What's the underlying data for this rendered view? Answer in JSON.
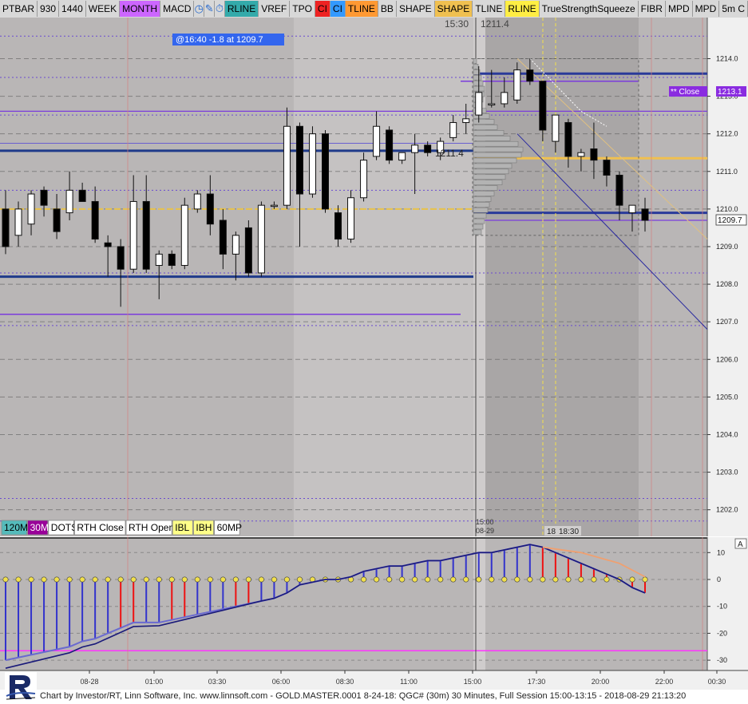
{
  "toolbar": [
    {
      "label": "PTBAR",
      "bg": "#d8d8d8"
    },
    {
      "label": "930",
      "bg": "#d8d8d8"
    },
    {
      "label": "1440",
      "bg": "#d8d8d8"
    },
    {
      "label": "WEEK",
      "bg": "#d8d8d8"
    },
    {
      "label": "MONTH",
      "bg": "#cc66ff"
    },
    {
      "label": "MACD",
      "bg": "#d8d8d8"
    },
    {
      "icon": "clock-icon",
      "bg": "#d8d8d8"
    },
    {
      "icon": "pencil-icon",
      "bg": "#d8d8d8"
    },
    {
      "icon": "stopwatch-icon",
      "bg": "#d8d8d8"
    },
    {
      "label": "RLINE",
      "bg": "#33aaaa"
    },
    {
      "label": "VREF",
      "bg": "#d8d8d8"
    },
    {
      "label": "TPO",
      "bg": "#d8d8d8"
    },
    {
      "label": "CI",
      "bg": "#ee2222"
    },
    {
      "label": "CI",
      "bg": "#3399ff"
    },
    {
      "label": "TLINE",
      "bg": "#ff9933"
    },
    {
      "label": "BB",
      "bg": "#d8d8d8"
    },
    {
      "label": "SHAPE",
      "bg": "#d8d8d8"
    },
    {
      "label": "SHAPE",
      "bg": "#f0c050"
    },
    {
      "label": "TLINE",
      "bg": "#d8d8d8"
    },
    {
      "label": "RLINE",
      "bg": "#ffee44"
    },
    {
      "label": "TrueStrengthSqueeze",
      "bg": "#d8d8d8"
    },
    {
      "label": "FIBR",
      "bg": "#d8d8d8"
    },
    {
      "label": "MPD",
      "bg": "#d8d8d8"
    },
    {
      "label": "MPD",
      "bg": "#d8d8d8"
    },
    {
      "label": "5m C",
      "bg": "#d8d8d8"
    }
  ],
  "bottom_buttons": [
    {
      "label": "120M",
      "bg": "#55bbbb"
    },
    {
      "label": "30M",
      "bg": "#990099",
      "color": "#ffffff"
    },
    {
      "label": "DOTS",
      "bg": "#ffffff"
    },
    {
      "label": "RTH Close",
      "bg": "#ffffff"
    },
    {
      "label": "RTH Open",
      "bg": "#ffffff"
    },
    {
      "label": "IBL",
      "bg": "#ffff88"
    },
    {
      "label": "IBH",
      "bg": "#ffff88"
    },
    {
      "label": "60MP",
      "bg": "#ffffff"
    }
  ],
  "cursor_info": "@16:40  -1.8 at 1209.7",
  "session_label_time": "15:30",
  "session_label_price": "1211.4",
  "mid_label": "1211.4",
  "close_tag": "** Close",
  "close_value": "1213.1",
  "last_price": "1209.7",
  "vline_label_time": "15:00",
  "vline_label_date": "08-29",
  "ib_label_1": "18",
  "ib_label_2": "18:30",
  "osc_pane_label": "A",
  "footer": "Chart by Investor/RT, Linn Software, Inc. www.linnsoft.com - GOLD.MASTER.0001  8-24-18: QGC# (30m) 30 Minutes, Full Session 15:00-13:15 - 2018-08-29 21:13:20",
  "chart_data": {
    "type": "candlestick",
    "price_ticks": [
      1214.0,
      1213.0,
      1212.0,
      1211.0,
      1210.0,
      1209.0,
      1208.0,
      1207.0,
      1206.0,
      1205.0,
      1204.0,
      1203.0,
      1202.0
    ],
    "price_range": [
      1201.55,
      1214.8
    ],
    "time_ticks": [
      "08-28",
      "01:00",
      "03:30",
      "06:00",
      "08:30",
      "11:00",
      "15:00",
      "17:30",
      "20:00",
      "22:00",
      "00:30"
    ],
    "candles": [
      {
        "o": 1210.0,
        "h": 1210.5,
        "l": 1208.8,
        "c": 1209.0
      },
      {
        "o": 1209.3,
        "h": 1210.2,
        "l": 1209.0,
        "c": 1210.0
      },
      {
        "o": 1209.6,
        "h": 1210.5,
        "l": 1209.3,
        "c": 1210.4
      },
      {
        "o": 1210.5,
        "h": 1210.6,
        "l": 1209.8,
        "c": 1210.1
      },
      {
        "o": 1210.0,
        "h": 1210.4,
        "l": 1209.2,
        "c": 1209.4
      },
      {
        "o": 1209.9,
        "h": 1211.0,
        "l": 1209.7,
        "c": 1210.5
      },
      {
        "o": 1210.5,
        "h": 1210.7,
        "l": 1210.2,
        "c": 1210.2
      },
      {
        "o": 1210.2,
        "h": 1210.6,
        "l": 1209.1,
        "c": 1209.2
      },
      {
        "o": 1209.1,
        "h": 1209.3,
        "l": 1208.2,
        "c": 1209.0
      },
      {
        "o": 1209.0,
        "h": 1209.2,
        "l": 1207.4,
        "c": 1208.4
      },
      {
        "o": 1208.4,
        "h": 1210.9,
        "l": 1208.3,
        "c": 1210.2
      },
      {
        "o": 1210.2,
        "h": 1210.9,
        "l": 1208.3,
        "c": 1208.4
      },
      {
        "o": 1208.5,
        "h": 1208.9,
        "l": 1207.6,
        "c": 1208.8
      },
      {
        "o": 1208.8,
        "h": 1208.9,
        "l": 1208.4,
        "c": 1208.5
      },
      {
        "o": 1208.5,
        "h": 1210.3,
        "l": 1208.4,
        "c": 1210.1
      },
      {
        "o": 1210.0,
        "h": 1210.5,
        "l": 1209.9,
        "c": 1210.4
      },
      {
        "o": 1210.4,
        "h": 1210.9,
        "l": 1209.3,
        "c": 1209.6
      },
      {
        "o": 1209.7,
        "h": 1210.0,
        "l": 1208.4,
        "c": 1208.8
      },
      {
        "o": 1208.8,
        "h": 1209.4,
        "l": 1208.1,
        "c": 1209.3
      },
      {
        "o": 1209.5,
        "h": 1209.7,
        "l": 1208.2,
        "c": 1208.3
      },
      {
        "o": 1208.3,
        "h": 1210.2,
        "l": 1208.2,
        "c": 1210.1
      },
      {
        "o": 1210.1,
        "h": 1210.2,
        "l": 1210.0,
        "c": 1210.1
      },
      {
        "o": 1210.1,
        "h": 1212.7,
        "l": 1210.0,
        "c": 1212.2
      },
      {
        "o": 1212.2,
        "h": 1212.3,
        "l": 1209.0,
        "c": 1210.4
      },
      {
        "o": 1210.4,
        "h": 1212.2,
        "l": 1210.3,
        "c": 1212.0
      },
      {
        "o": 1212.0,
        "h": 1212.1,
        "l": 1209.9,
        "c": 1210.0
      },
      {
        "o": 1209.9,
        "h": 1210.1,
        "l": 1209.0,
        "c": 1209.2
      },
      {
        "o": 1209.2,
        "h": 1210.5,
        "l": 1209.1,
        "c": 1210.3
      },
      {
        "o": 1210.3,
        "h": 1211.5,
        "l": 1210.2,
        "c": 1211.3
      },
      {
        "o": 1211.4,
        "h": 1212.6,
        "l": 1211.3,
        "c": 1212.2
      },
      {
        "o": 1212.1,
        "h": 1212.2,
        "l": 1211.2,
        "c": 1211.3
      },
      {
        "o": 1211.3,
        "h": 1211.5,
        "l": 1211.2,
        "c": 1211.5
      },
      {
        "o": 1211.5,
        "h": 1212.0,
        "l": 1210.4,
        "c": 1211.7
      },
      {
        "o": 1211.7,
        "h": 1211.8,
        "l": 1211.4,
        "c": 1211.5
      },
      {
        "o": 1211.5,
        "h": 1211.9,
        "l": 1211.3,
        "c": 1211.8
      },
      {
        "o": 1211.9,
        "h": 1212.5,
        "l": 1211.8,
        "c": 1212.3
      },
      {
        "o": 1212.3,
        "h": 1212.8,
        "l": 1212.0,
        "c": 1212.4
      },
      {
        "o": 1212.5,
        "h": 1213.8,
        "l": 1212.3,
        "c": 1213.1
      },
      {
        "o": 1212.8,
        "h": 1213.7,
        "l": 1212.7,
        "c": 1212.8
      },
      {
        "o": 1212.8,
        "h": 1213.5,
        "l": 1212.7,
        "c": 1213.1
      },
      {
        "o": 1212.9,
        "h": 1213.9,
        "l": 1212.8,
        "c": 1213.7
      },
      {
        "o": 1213.7,
        "h": 1214.0,
        "l": 1213.3,
        "c": 1213.4
      },
      {
        "o": 1213.4,
        "h": 1213.4,
        "l": 1211.8,
        "c": 1212.1
      },
      {
        "o": 1211.8,
        "h": 1212.5,
        "l": 1211.5,
        "c": 1212.5
      },
      {
        "o": 1212.3,
        "h": 1212.4,
        "l": 1211.1,
        "c": 1211.4
      },
      {
        "o": 1211.4,
        "h": 1211.6,
        "l": 1211.0,
        "c": 1211.5
      },
      {
        "o": 1211.6,
        "h": 1212.3,
        "l": 1210.8,
        "c": 1211.3
      },
      {
        "o": 1211.3,
        "h": 1211.4,
        "l": 1210.6,
        "c": 1210.9
      },
      {
        "o": 1210.9,
        "h": 1211.0,
        "l": 1209.7,
        "c": 1210.1
      },
      {
        "o": 1209.9,
        "h": 1210.1,
        "l": 1209.4,
        "c": 1210.1
      },
      {
        "o": 1210.0,
        "h": 1210.3,
        "l": 1209.4,
        "c": 1209.7
      }
    ],
    "oscillator": {
      "ticks": [
        10,
        0,
        -10,
        -20,
        -30
      ],
      "range": [
        -31,
        15
      ],
      "histogram": [
        -30,
        -29,
        -28,
        -27,
        -26,
        -25,
        -23,
        -22,
        -20,
        -18,
        -16,
        -16,
        -16,
        -15,
        -14,
        -13,
        -12,
        -11,
        -10,
        -9,
        -8,
        -7,
        -5,
        -2,
        -1,
        0,
        0,
        1,
        3,
        4,
        5,
        5,
        6,
        7,
        7,
        8,
        9,
        10,
        10,
        11,
        12,
        13,
        12,
        10,
        8,
        6,
        4,
        2,
        0,
        -3,
        -5
      ],
      "hist_red": [
        false,
        false,
        false,
        false,
        false,
        false,
        false,
        false,
        false,
        true,
        true,
        false,
        false,
        true,
        true,
        false,
        false,
        false,
        true,
        true,
        false,
        false,
        false,
        false,
        true,
        true,
        false,
        false,
        false,
        false,
        false,
        false,
        false,
        false,
        false,
        false,
        false,
        false,
        false,
        false,
        false,
        false,
        true,
        true,
        true,
        true,
        true,
        true,
        true,
        true,
        true
      ]
    }
  }
}
